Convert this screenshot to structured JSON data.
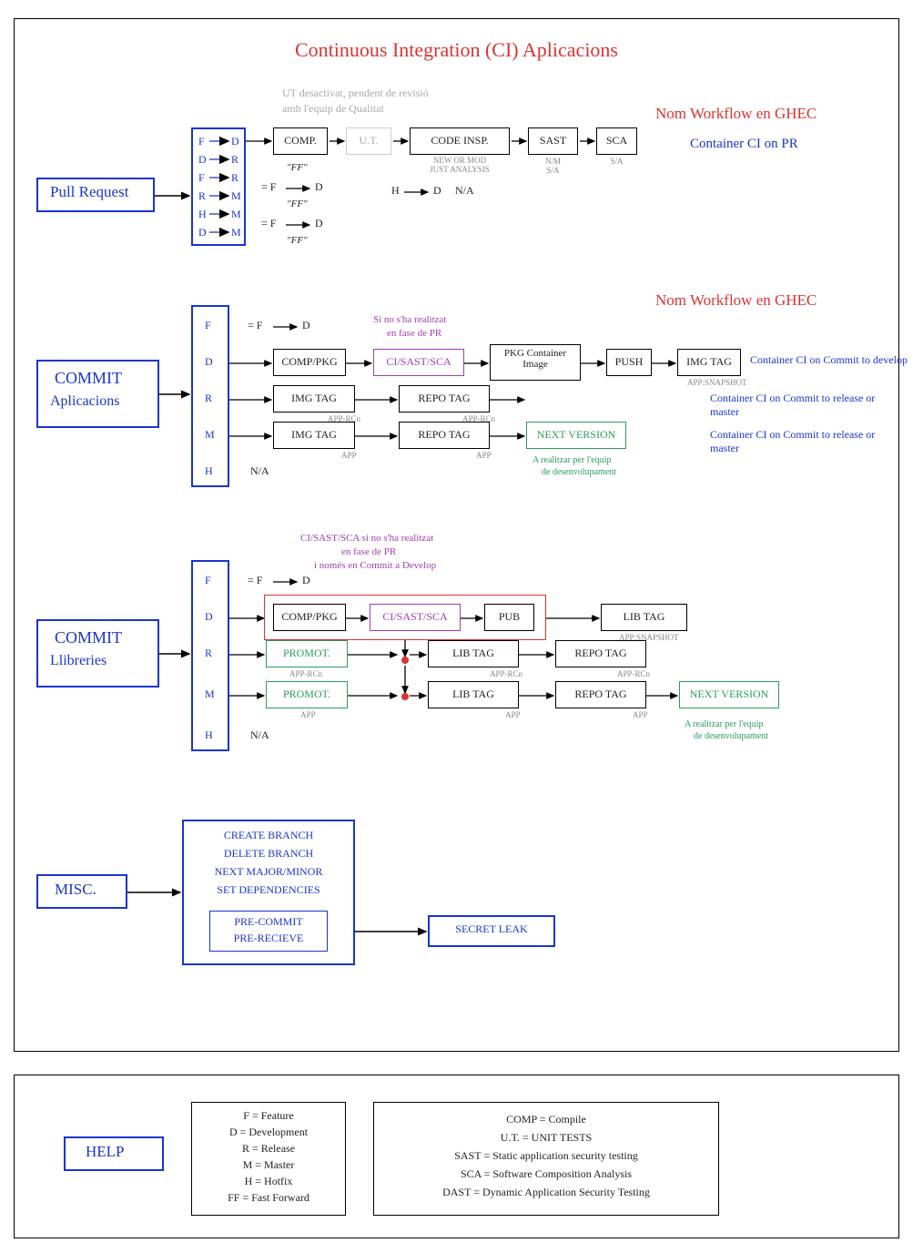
{
  "title": "Continuous Integration (CI) Aplicacions",
  "frame_note1": "UT desactivat, pendent de revisió",
  "frame_note2": "amb l'equip de Qualitat",
  "ghec_header": "Nom Workflow en GHEC",
  "wf_pr": "Container CI on PR",
  "pr": {
    "label": "Pull Request",
    "branches": [
      "F",
      "D",
      "F",
      "R",
      "H",
      "D"
    ],
    "targets": [
      "D",
      "R",
      "R",
      "M",
      "M",
      "M"
    ],
    "steps": {
      "comp": "COMP.",
      "ut": "U.T.",
      "ci": "CODE INSP.",
      "sast": "SAST",
      "sca": "SCA"
    },
    "sub_ci1": "NEW OR MOD",
    "sub_ci2": "JUST ANALYSIS",
    "sub_sast": "N/M\nS/A",
    "sub_sca": "S/A",
    "ff": "\"FF\"",
    "eq_fd_1": "= F",
    "eq_fd_2": "D",
    "na": "N/A",
    "h_d_h": "H",
    "h_d_d": "D"
  },
  "commit_app": {
    "label1": "COMMIT",
    "label2": "Aplicacions",
    "branches": [
      "F",
      "D",
      "R",
      "M",
      "H"
    ],
    "eq_fd_1": "= F",
    "eq_fd_2": "D",
    "note1": "Si no s'ha realitzat",
    "note2": "en fase de PR",
    "steps": {
      "comp": "COMP/PKG",
      "cisast": "CI/SAST/SCA",
      "pkg": "PKG Container\nImage",
      "push": "PUSH",
      "imgtag": "IMG TAG",
      "repotag": "REPO TAG",
      "nextv": "NEXT VERSION"
    },
    "sub_apprc": "APP-RCn",
    "sub_app": "APP",
    "sub_snap": "APP:SNAPSHOT",
    "wf_dev": "Container CI on Commit to develop",
    "wf_rel": "Container CI on Commit to release or master",
    "note_dev1": "A realitzar per l'equip",
    "note_dev2": "de desenvolupament",
    "na": "N/A"
  },
  "commit_lib": {
    "label1": "COMMIT",
    "label2": "Llibreries",
    "branches": [
      "F",
      "D",
      "R",
      "M",
      "H"
    ],
    "eq_fd_1": "= F",
    "eq_fd_2": "D",
    "note0": "CI/SAST/SCA si no s'ha realitzat",
    "note1": "en fase de PR",
    "note2": "i només en Commit a Develop",
    "steps": {
      "comp": "COMP/PKG",
      "cisast": "CI/SAST/SCA",
      "pub": "PUB",
      "libtag": "LIB TAG",
      "promot": "PROMOT.",
      "repotag": "REPO TAG",
      "nextv": "NEXT VERSION"
    },
    "sub_apprc": "APP-RCn",
    "sub_app": "APP",
    "sub_snap": "APP:SNAPSHOT",
    "note_dev1": "A realitzar per l'equip",
    "note_dev2": "de desenvolupament",
    "na": "N/A"
  },
  "misc": {
    "label": "MISC.",
    "items": [
      "CREATE BRANCH",
      "DELETE BRANCH",
      "NEXT MAJOR/MINOR",
      "SET DEPENDENCIES",
      "PRE-COMMIT",
      "PRE-RECIEVE"
    ],
    "secret": "SECRET LEAK"
  },
  "help": {
    "label": "HELP",
    "left": [
      "F = Feature",
      "D = Development",
      "R = Release",
      "M = Master",
      "H = Hotfix",
      "FF = Fast Forward"
    ],
    "right": [
      "COMP = Compile",
      "U.T. = UNIT TESTS",
      "SAST = Static application security testing",
      "SCA = Software Composition Analysis",
      "DAST = Dynamic Application Security Testing"
    ]
  }
}
